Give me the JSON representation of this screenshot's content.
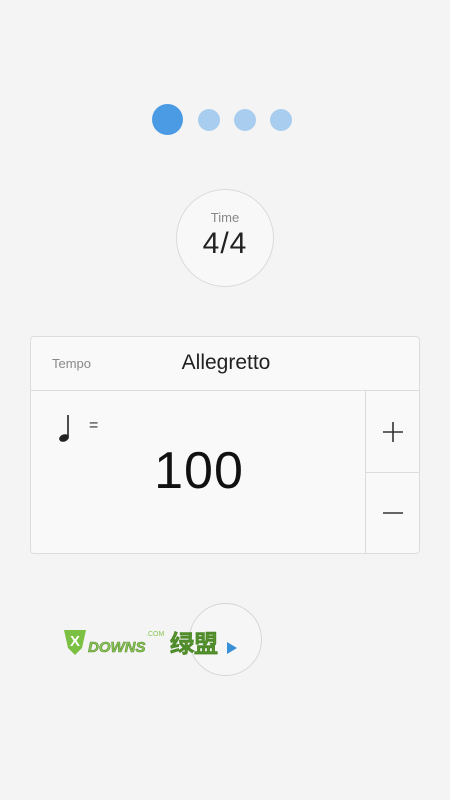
{
  "pager": {
    "total": 4,
    "active_index": 0
  },
  "time_signature": {
    "label": "Time",
    "value": "4/4"
  },
  "tempo": {
    "label": "Tempo",
    "name": "Allegretto",
    "note_icon": "quarter-note-icon",
    "equals": "=",
    "bpm": "100",
    "increment_icon": "plus-icon",
    "decrement_icon": "minus-icon"
  },
  "play_button": {
    "icon": "play-icon"
  },
  "watermark": {
    "text": "XDOWNS 绿盟",
    "sub": ".COM"
  },
  "colors": {
    "accent": "#4a9be3",
    "accent_light": "#a9cdef",
    "background": "#f4f4f4"
  }
}
